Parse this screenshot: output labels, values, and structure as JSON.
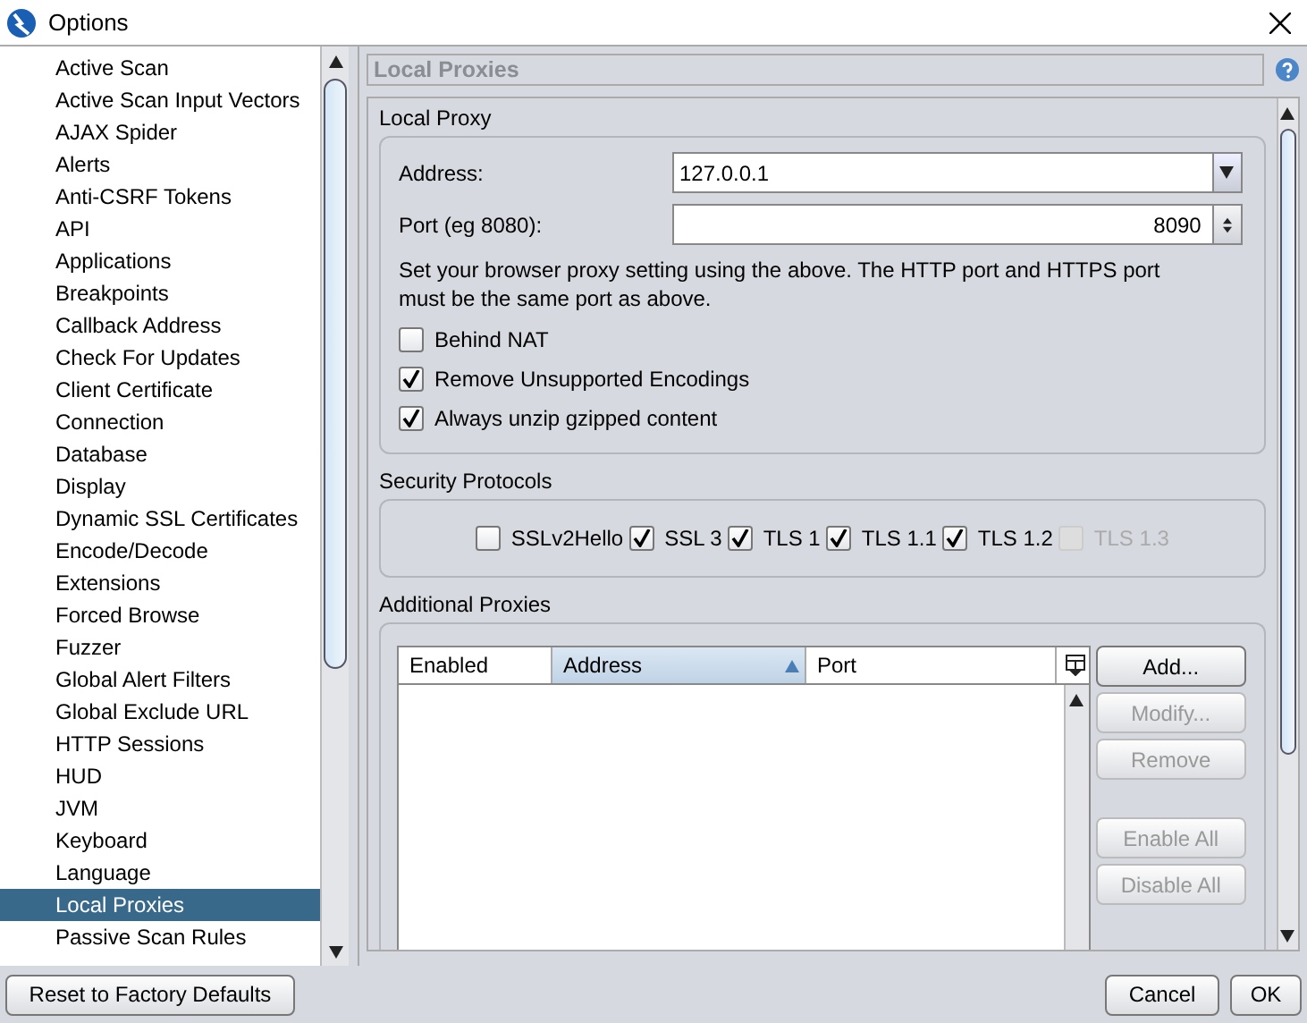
{
  "window": {
    "title": "Options"
  },
  "sidebar": {
    "items": [
      {
        "label": "Active Scan",
        "selected": false
      },
      {
        "label": "Active Scan Input Vectors",
        "selected": false
      },
      {
        "label": "AJAX Spider",
        "selected": false
      },
      {
        "label": "Alerts",
        "selected": false
      },
      {
        "label": "Anti-CSRF Tokens",
        "selected": false
      },
      {
        "label": "API",
        "selected": false
      },
      {
        "label": "Applications",
        "selected": false
      },
      {
        "label": "Breakpoints",
        "selected": false
      },
      {
        "label": "Callback Address",
        "selected": false
      },
      {
        "label": "Check For Updates",
        "selected": false
      },
      {
        "label": "Client Certificate",
        "selected": false
      },
      {
        "label": "Connection",
        "selected": false
      },
      {
        "label": "Database",
        "selected": false
      },
      {
        "label": "Display",
        "selected": false
      },
      {
        "label": "Dynamic SSL Certificates",
        "selected": false
      },
      {
        "label": "Encode/Decode",
        "selected": false
      },
      {
        "label": "Extensions",
        "selected": false
      },
      {
        "label": "Forced Browse",
        "selected": false
      },
      {
        "label": "Fuzzer",
        "selected": false
      },
      {
        "label": "Global Alert Filters",
        "selected": false
      },
      {
        "label": "Global Exclude URL",
        "selected": false
      },
      {
        "label": "HTTP Sessions",
        "selected": false
      },
      {
        "label": "HUD",
        "selected": false
      },
      {
        "label": "JVM",
        "selected": false
      },
      {
        "label": "Keyboard",
        "selected": false
      },
      {
        "label": "Language",
        "selected": false
      },
      {
        "label": "Local Proxies",
        "selected": true
      },
      {
        "label": "Passive Scan Rules",
        "selected": false
      }
    ]
  },
  "panel": {
    "title": "Local Proxies",
    "local_proxy": {
      "heading": "Local Proxy",
      "address_label": "Address:",
      "address": "127.0.0.1",
      "port_label": "Port (eg 8080):",
      "port": "8090",
      "note": "Set your browser proxy setting using the above.  The HTTP port and HTTPS port must be the same port as above.",
      "options": [
        {
          "label": "Behind NAT",
          "checked": false
        },
        {
          "label": "Remove Unsupported Encodings",
          "checked": true
        },
        {
          "label": "Always unzip gzipped content",
          "checked": true
        }
      ]
    },
    "security_protocols": {
      "heading": "Security Protocols",
      "protocols": [
        {
          "label": "SSLv2Hello",
          "checked": false,
          "disabled": false
        },
        {
          "label": "SSL 3",
          "checked": true,
          "disabled": false
        },
        {
          "label": "TLS 1",
          "checked": true,
          "disabled": false
        },
        {
          "label": "TLS 1.1",
          "checked": true,
          "disabled": false
        },
        {
          "label": "TLS 1.2",
          "checked": true,
          "disabled": false
        },
        {
          "label": "TLS 1.3",
          "checked": false,
          "disabled": true
        }
      ]
    },
    "additional_proxies": {
      "heading": "Additional Proxies",
      "columns": [
        {
          "label": "Enabled",
          "sorted": false
        },
        {
          "label": "Address",
          "sorted": true
        },
        {
          "label": "Port",
          "sorted": false
        }
      ],
      "buttons": [
        {
          "label": "Add...",
          "disabled": false
        },
        {
          "label": "Modify...",
          "disabled": true
        },
        {
          "label": "Remove",
          "disabled": true
        },
        {
          "label": "Enable All",
          "disabled": true
        },
        {
          "label": "Disable All",
          "disabled": true
        }
      ]
    }
  },
  "footer": {
    "reset": "Reset to Factory Defaults",
    "buttons": [
      "Cancel",
      "OK"
    ]
  }
}
